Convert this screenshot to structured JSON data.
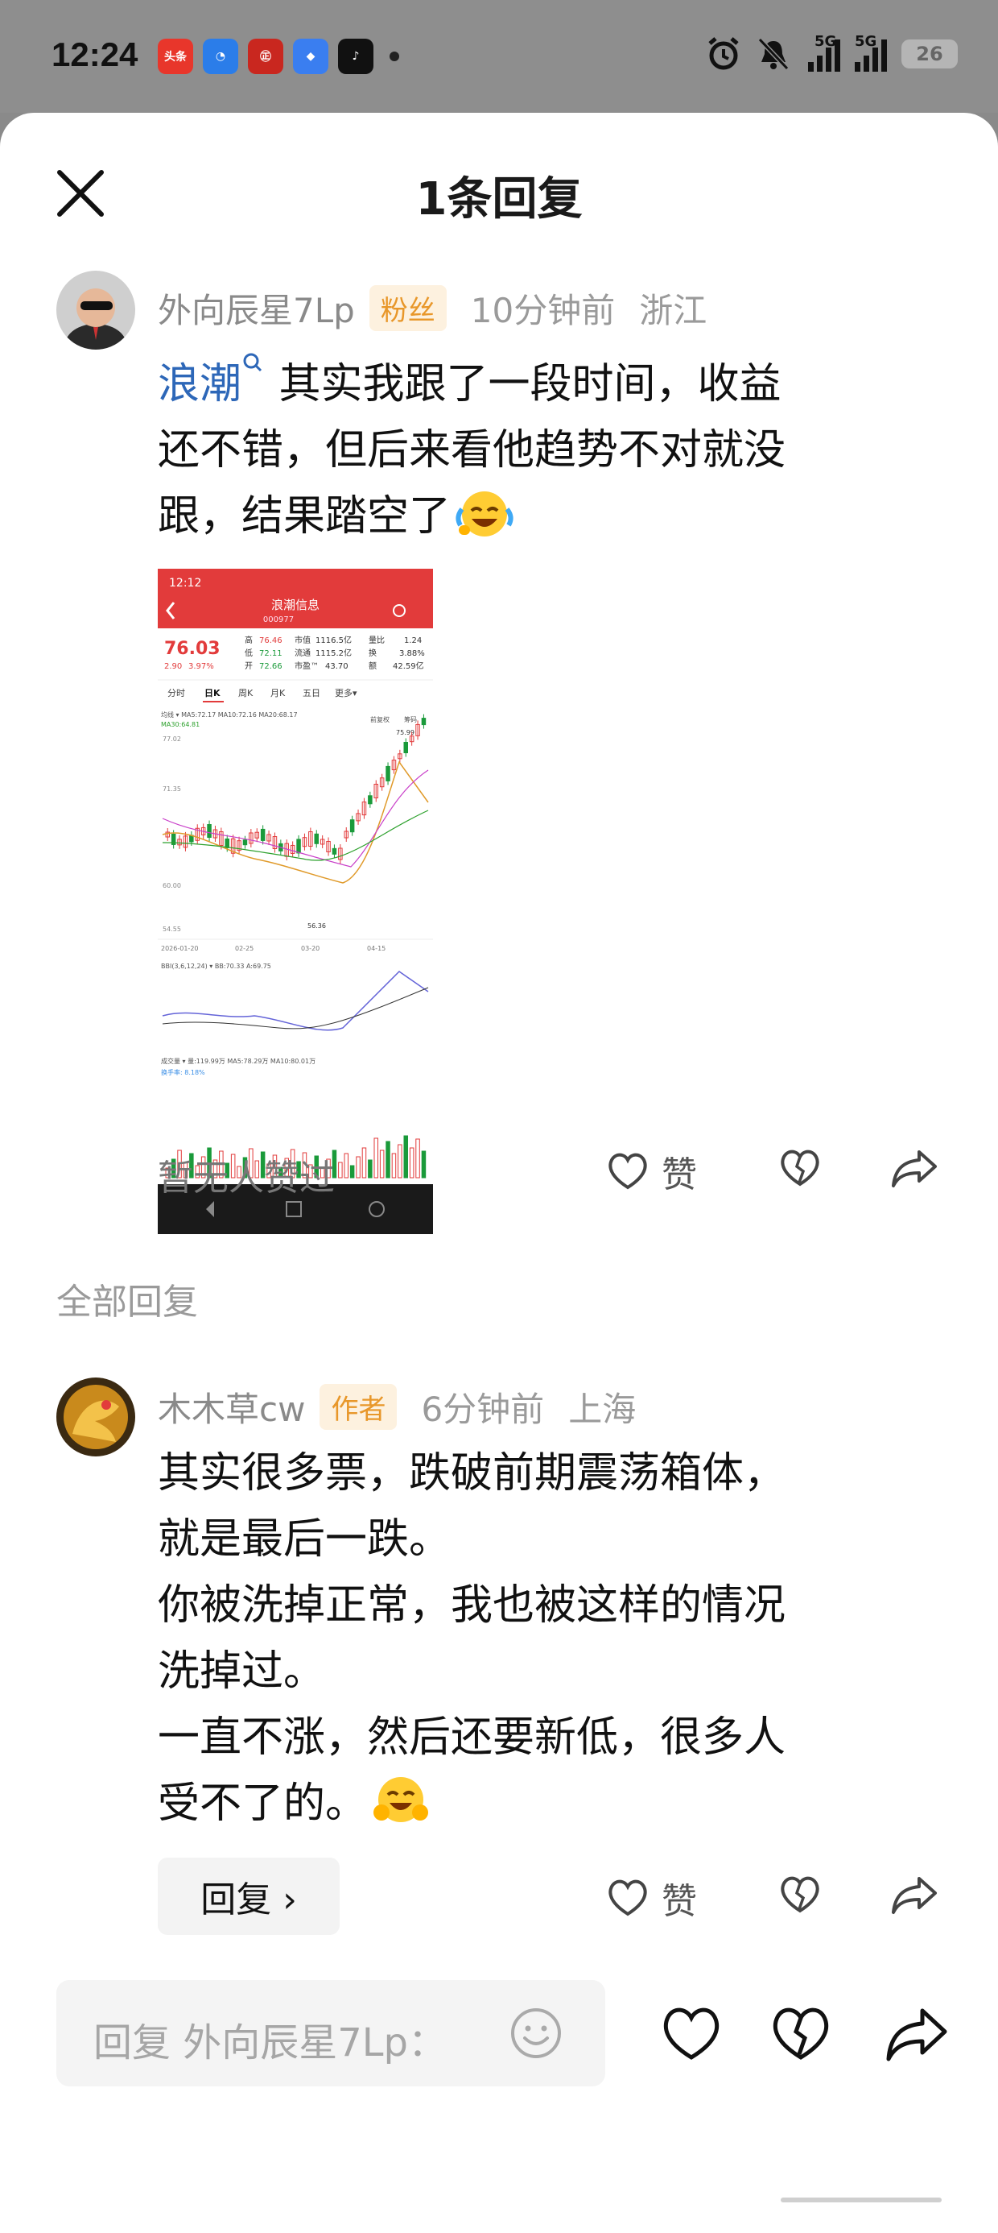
{
  "status_bar": {
    "time": "12:24",
    "apps": [
      {
        "name": "toutiao-app-icon",
        "label": "头条",
        "color": "#e8362b"
      },
      {
        "name": "app-blue-icon",
        "label": "◔",
        "color": "#2b7de9"
      },
      {
        "name": "app-red-circle-icon",
        "label": "㊣",
        "color": "#c9271f"
      },
      {
        "name": "app-blue-square-icon",
        "label": "◆",
        "color": "#3a7ef0"
      },
      {
        "name": "tiktok-icon",
        "label": "♪",
        "color": "#111111"
      }
    ],
    "network1": "5G",
    "network2": "5G",
    "battery": "26"
  },
  "header": {
    "title": "1条回复"
  },
  "main_comment": {
    "username": "外向辰星7Lp",
    "badge": "粉丝",
    "time": "10分钟前",
    "location": "浙江",
    "link_text": "浪潮",
    "text_line1": "其实我跟了一段时间，收益",
    "text_line2": "还不错，但后来看他趋势不对就没",
    "text_line3": "跟，结果踏空了",
    "likes_text": "暂无人赞过",
    "like_label": "赞"
  },
  "stock_screenshot": {
    "status_time": "12:12",
    "stock_name": "浪潮信息",
    "stock_code": "000977",
    "price": "76.03",
    "change": "2.90",
    "change_pct": "3.97%",
    "stats": {
      "high_label": "高",
      "high": "76.46",
      "low_label": "低",
      "low": "72.11",
      "open_label": "开",
      "open": "72.66",
      "mcap_label": "市值",
      "mcap": "1116.5亿",
      "float_label": "流通",
      "float": "1115.2亿",
      "pe_label": "市盈™",
      "pe": "43.70",
      "vr_label": "量比",
      "vr": "1.24",
      "turn_label": "换",
      "turn": "3.88%",
      "amt_label": "额",
      "amt": "42.59亿"
    },
    "tabs": [
      "分时",
      "日K",
      "周K",
      "月K",
      "五日",
      "更多▾"
    ],
    "ma_line": "均线 ▾  MA5:72.17  MA10:72.16  MA20:68.17",
    "ma30": "MA30:64.81",
    "rights_label": "前复权",
    "chip_label": "筹码",
    "axis_top": "77.02",
    "axis_mid": "71.35",
    "axis_low": "60.00",
    "axis_bottom": "54.55",
    "peak_label": "75.99",
    "low_label2": "56.36",
    "dates": [
      "2026-01-20",
      "02-25",
      "03-20",
      "04-15"
    ],
    "bbi": "BBI(3,6,12,24) ▾  BB:70.33  A:69.75",
    "volume": "成交量 ▾  量:119.99万  MA5:78.29万  MA10:80.01万",
    "turnover": "换手率: 8.18%"
  },
  "all_replies_label": "全部回复",
  "reply": {
    "username": "木木草cw",
    "badge": "作者",
    "time": "6分钟前",
    "location": "上海",
    "lines": [
      "其实很多票，跌破前期震荡箱体，",
      "就是最后一跌。",
      "你被洗掉正常，我也被这样的情况",
      "洗掉过。",
      "一直不涨，然后还要新低，很多人",
      "受不了的。"
    ],
    "reply_button": "回复 ›",
    "like_label": "赞"
  },
  "bottom_bar": {
    "input_placeholder": "回复 外向辰星7Lp："
  }
}
